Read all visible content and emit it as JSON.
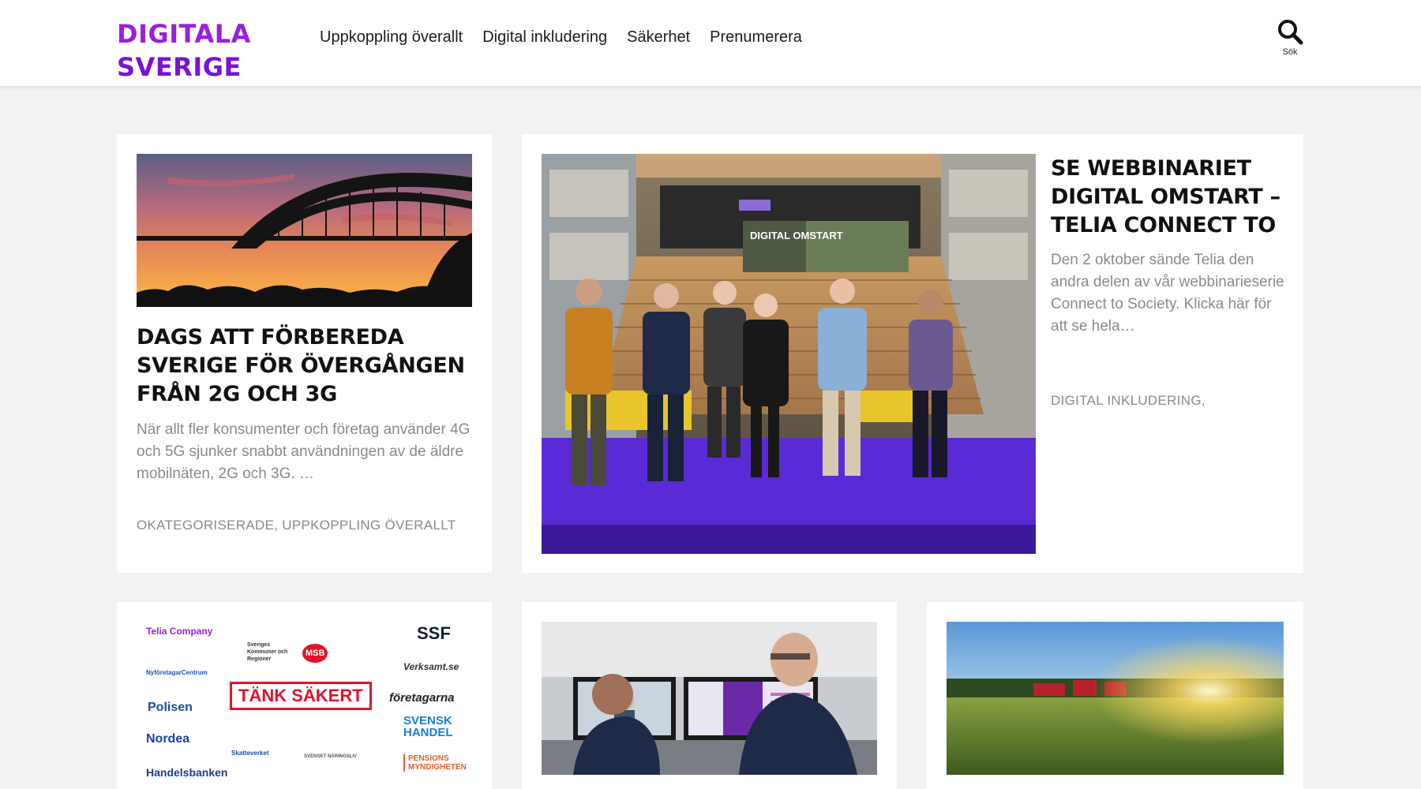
{
  "header": {
    "logo_line1": "DIGITALA",
    "logo_line2": "SVERIGE",
    "nav": [
      "Uppkoppling överallt",
      "Digital inkludering",
      "Säkerhet",
      "Prenumerera"
    ],
    "search_label": "Sök"
  },
  "colors": {
    "brand_purple": "#9a1fe0",
    "card_bg": "#ffffff",
    "page_bg": "#f2f2f2",
    "muted_text": "#8a8a8a",
    "stage_purple": "#5a2ad6"
  },
  "articles": [
    {
      "title": "DAGS ATT FÖRBEREDA SVERIGE FÖR ÖVERGÅNGEN FRÅN 2G OCH 3G",
      "excerpt": "När allt fler konsumenter och företag använder 4G och 5G sjunker snabbt användningen av de äldre mobilnäten, 2G och 3G. …",
      "categories": [
        "OKATEGORISERADE",
        "UPPKOPPLING ÖVERALLT"
      ],
      "image_icon": "bridge-sunset-photo"
    },
    {
      "title": "SE WEBBINARIET DIGITAL OMSTART – TELIA CONNECT TO",
      "excerpt": "Den 2 oktober sände Telia den andra delen av vår webbinarieserie Connect to Society. Klicka här för att se hela…",
      "categories": [
        "DIGITAL INKLUDERING"
      ],
      "image_icon": "webinar-group-photo",
      "image_sign": "DIGITAL OMSTART"
    },
    {
      "image_icon": "partner-logos-image",
      "logos": [
        "Telia Company",
        "Sveriges Kommuner och Regioner",
        "MSB",
        "SSF",
        "NyföretagarCentrum",
        "Verksamt.se",
        "Polisen",
        "TÄNK SÄKERT",
        "företagarna",
        "Nordea",
        "Skatteverket",
        "SVENSK HANDEL",
        "Handelsbanken",
        "SVENSKT NÄRINGSLIV",
        "PENSIONS MYNDIGHETEN"
      ]
    },
    {
      "image_icon": "office-monitors-photo"
    },
    {
      "image_icon": "farm-field-sunset-photo"
    }
  ]
}
